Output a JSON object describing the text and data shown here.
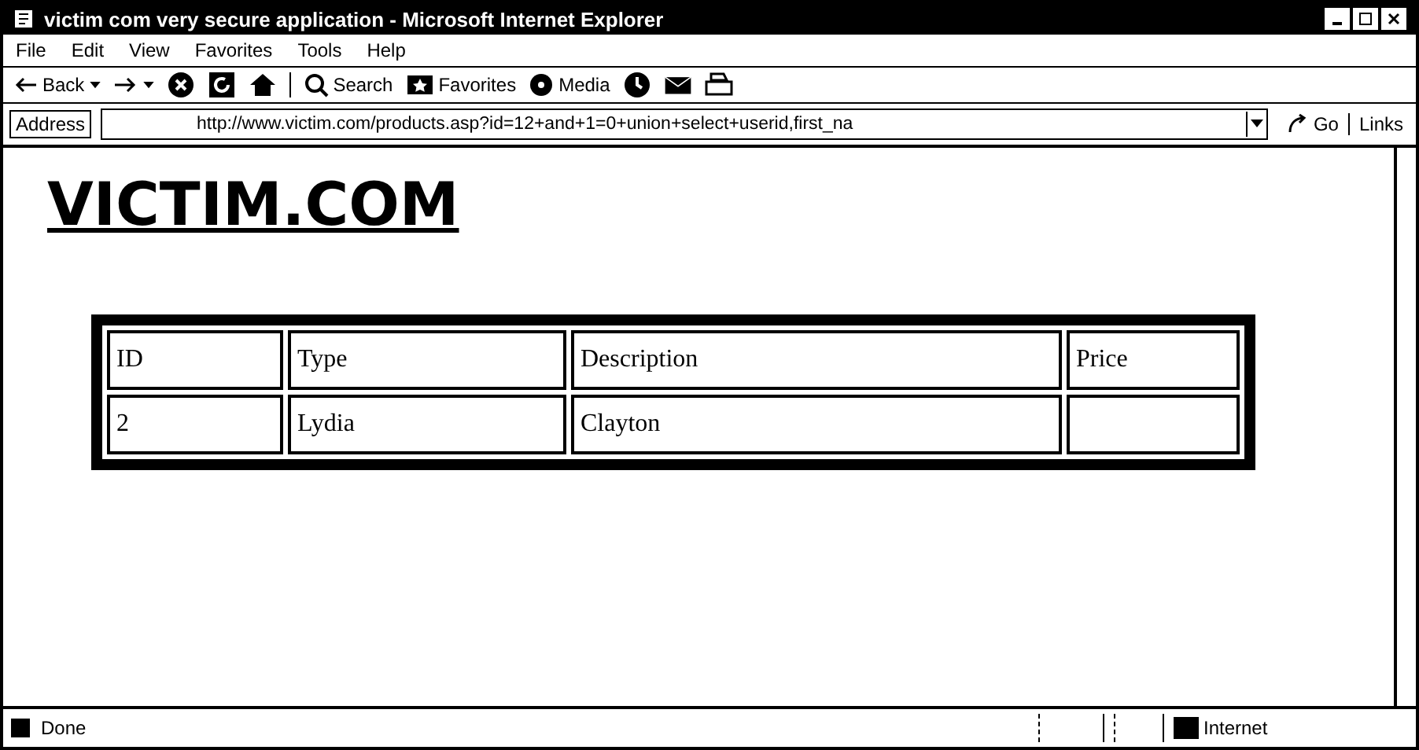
{
  "window": {
    "title": "victim com very secure application - Microsoft Internet Explorer"
  },
  "menu": [
    "File",
    "Edit",
    "View",
    "Favorites",
    "Tools",
    "Help"
  ],
  "toolbar": [
    {
      "kind": "back",
      "label": "Back"
    },
    {
      "kind": "forward"
    },
    {
      "kind": "stop"
    },
    {
      "kind": "refresh"
    },
    {
      "kind": "home"
    },
    {
      "kind": "search",
      "label": "Search"
    },
    {
      "kind": "favorites",
      "label": "Favorites"
    },
    {
      "kind": "media",
      "label": "Media"
    },
    {
      "kind": "history"
    },
    {
      "kind": "mail"
    },
    {
      "kind": "print"
    }
  ],
  "address_bar": {
    "label": "Address",
    "value": "http://www.victim.com/products.asp?id=12+and+1=0+union+select+userid,first_na",
    "go": "Go",
    "links": "Links"
  },
  "page": {
    "heading": "VICTIM.COM",
    "table": {
      "columns": [
        "ID",
        "Type",
        "Description",
        "Price"
      ],
      "rows": [
        [
          "2",
          "Lydia",
          "Clayton",
          ""
        ]
      ]
    }
  },
  "status_bar": {
    "text": "Done",
    "zone": "Internet"
  }
}
